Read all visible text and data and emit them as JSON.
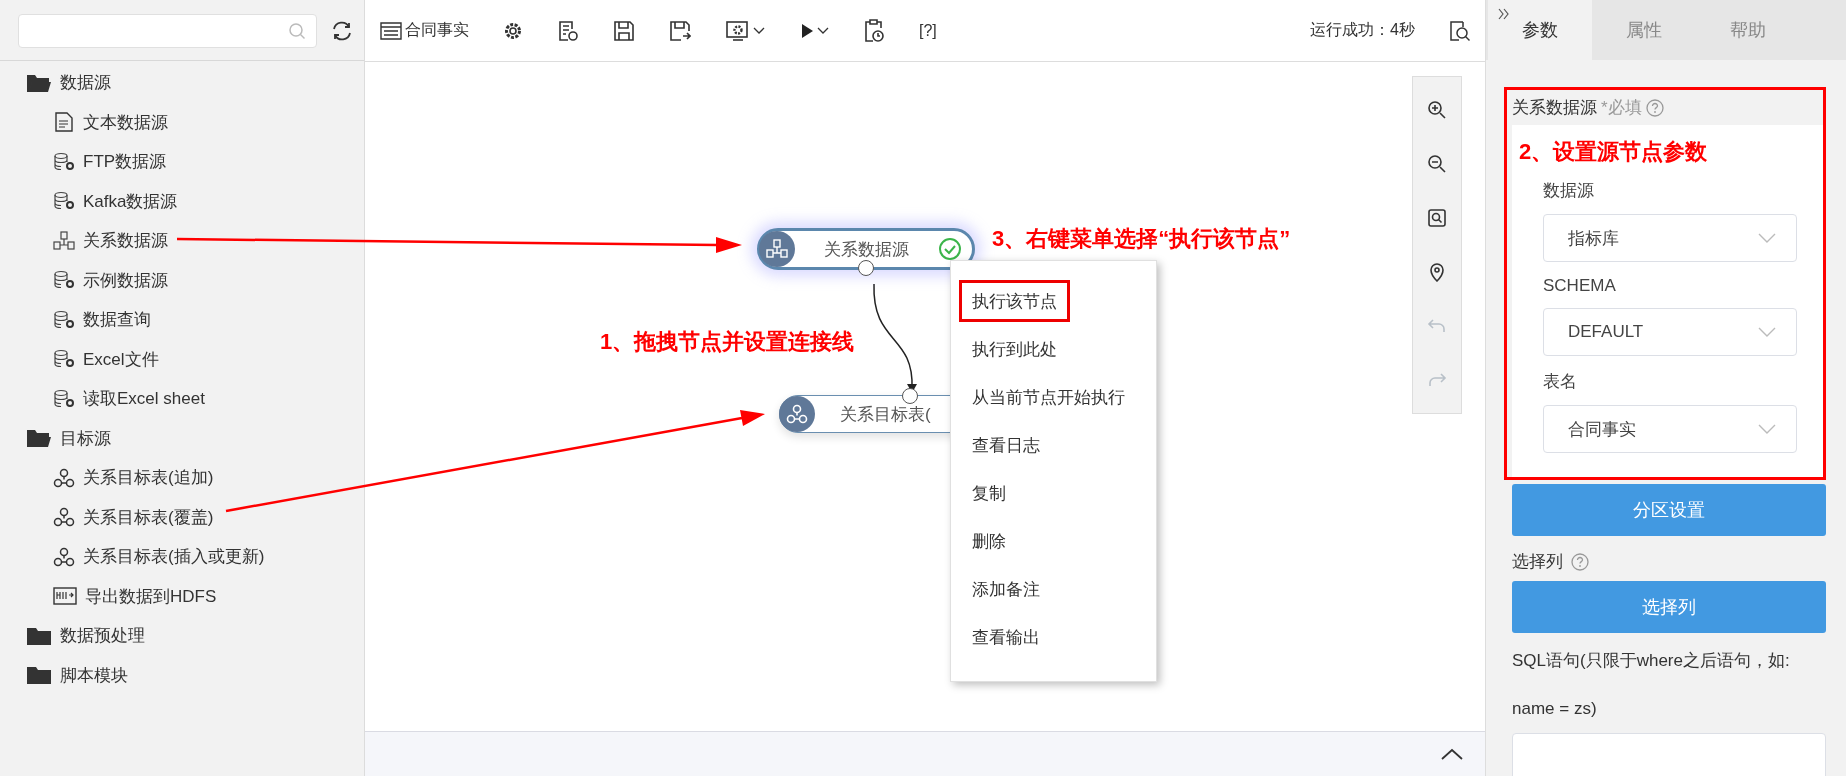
{
  "sidebar": {
    "tree": [
      {
        "label": "数据源",
        "expanded": true,
        "children": [
          {
            "label": "文本数据源",
            "kind": "text"
          },
          {
            "label": "FTP数据源",
            "kind": "db"
          },
          {
            "label": "Kafka数据源",
            "kind": "db"
          },
          {
            "label": "关系数据源",
            "kind": "relational"
          },
          {
            "label": "示例数据源",
            "kind": "db"
          },
          {
            "label": "数据查询",
            "kind": "db"
          },
          {
            "label": "Excel文件",
            "kind": "db"
          },
          {
            "label": "读取Excel sheet",
            "kind": "db"
          }
        ]
      },
      {
        "label": "目标源",
        "expanded": true,
        "children": [
          {
            "label": "关系目标表(追加)",
            "kind": "target"
          },
          {
            "label": "关系目标表(覆盖)",
            "kind": "target"
          },
          {
            "label": "关系目标表(插入或更新)",
            "kind": "target"
          },
          {
            "label": "导出数据到HDFS",
            "kind": "hdfs"
          }
        ]
      },
      {
        "label": "数据预处理",
        "expanded": false
      },
      {
        "label": "脚本模块",
        "expanded": false
      }
    ]
  },
  "toolbar": {
    "title": "合同事实",
    "tools": [
      {
        "kind": "settings"
      },
      {
        "kind": "report"
      },
      {
        "kind": "save"
      },
      {
        "kind": "save-as"
      },
      {
        "kind": "config"
      },
      {
        "kind": "run"
      },
      {
        "kind": "schedule"
      }
    ],
    "help": "[?]",
    "status": "运行成功：4秒"
  },
  "canvas": {
    "nodes": [
      {
        "label": "关系数据源",
        "kind": "relational",
        "selected": true,
        "succeeded": true
      },
      {
        "label": "关系目标表(",
        "kind": "target",
        "selected": false
      }
    ],
    "context_menu": [
      {
        "label": "执行该节点",
        "highlighted": true
      },
      {
        "label": "执行到此处",
        "highlighted": false
      },
      {
        "label": "从当前节点开始执行",
        "highlighted": false
      },
      {
        "label": "查看日志",
        "highlighted": false
      },
      {
        "label": "复制",
        "highlighted": false
      },
      {
        "label": "删除",
        "highlighted": false
      },
      {
        "label": "添加备注",
        "highlighted": false
      },
      {
        "label": "查看输出",
        "highlighted": false
      }
    ],
    "zoom_tools": [
      {
        "kind": "zoom-in",
        "disabled": false
      },
      {
        "kind": "zoom-out",
        "disabled": false
      },
      {
        "kind": "fit",
        "disabled": false
      },
      {
        "kind": "locate",
        "disabled": false
      },
      {
        "kind": "undo",
        "disabled": true
      },
      {
        "kind": "redo",
        "disabled": true
      }
    ],
    "annotations": [
      "3、右键菜单选择“执行该节点”",
      "1、拖拽节点并设置连接线"
    ]
  },
  "panel": {
    "tabs": [
      {
        "label": "参数",
        "selected": true
      },
      {
        "label": "属性",
        "selected": false
      },
      {
        "label": "帮助",
        "selected": false
      }
    ],
    "section": {
      "title": "关系数据源",
      "required": "*必填",
      "highlighted": true,
      "annotation": "2、设置源节点参数",
      "fields": [
        {
          "label": "数据源",
          "value": "指标库"
        },
        {
          "label": "SCHEMA",
          "value": "DEFAULT"
        },
        {
          "label": "表名",
          "value": "合同事实"
        }
      ]
    },
    "partition_button": "分区设置",
    "columns_label": "选择列",
    "columns_button": "选择列",
    "sql_label": "SQL语句(只限于where之后语句，如: name = zs)"
  }
}
